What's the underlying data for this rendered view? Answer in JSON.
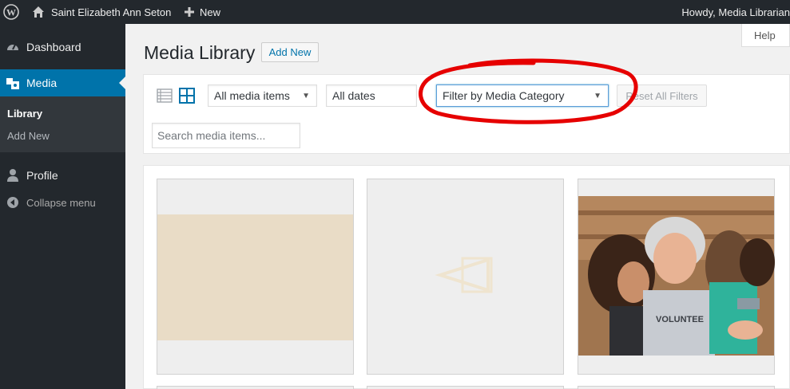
{
  "adminbar": {
    "site_name": "Saint Elizabeth Ann Seton",
    "new_label": "New",
    "howdy": "Howdy, Media Librarian"
  },
  "sidebar": {
    "items": [
      {
        "label": "Dashboard",
        "icon": "dashboard-icon"
      },
      {
        "label": "Media",
        "icon": "media-icon"
      },
      {
        "label": "Profile",
        "icon": "profile-icon"
      },
      {
        "label": "Collapse menu",
        "icon": "collapse-icon"
      }
    ],
    "submenu": [
      {
        "label": "Library"
      },
      {
        "label": "Add New"
      }
    ]
  },
  "help_label": "Help",
  "header": {
    "title": "Media Library",
    "add_new": "Add New"
  },
  "filters": {
    "type_selected": "All media items",
    "date_selected": "All dates",
    "category_selected": "Filter by Media Category",
    "reset": "Reset All Filters",
    "search_placeholder": "Search media items..."
  },
  "colors": {
    "admin_bar": "#23282d",
    "accent": "#0073aa",
    "annotation": "#e60000"
  }
}
